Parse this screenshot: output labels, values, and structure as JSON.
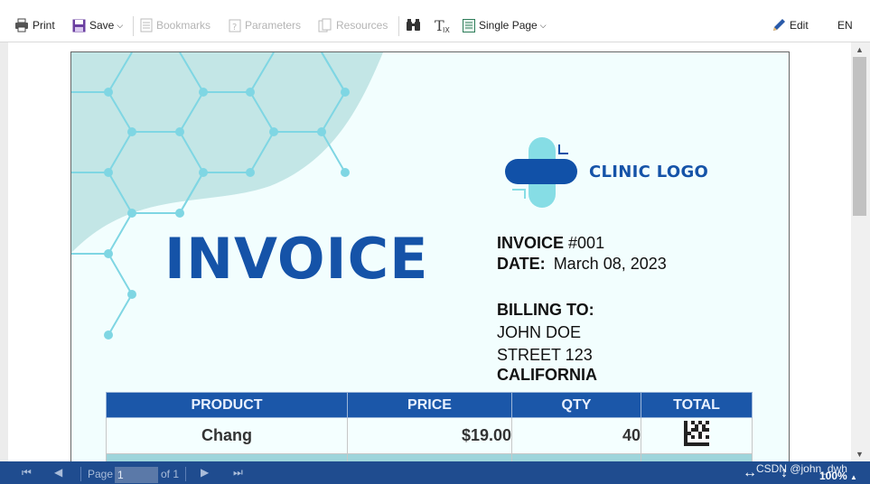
{
  "toolbar": {
    "print": "Print",
    "save": "Save",
    "bookmarks": "Bookmarks",
    "parameters": "Parameters",
    "resources": "Resources",
    "view_mode": "Single Page",
    "edit": "Edit",
    "language": "EN"
  },
  "invoice": {
    "logo_text": "CLINIC LOGO",
    "title": "INVOICE",
    "number_label": "INVOICE",
    "number_value": "#001",
    "date_label": "DATE:",
    "date_value": "March 08, 2023",
    "billing_label": "BILLING TO:",
    "billing_name": "JOHN DOE",
    "billing_street": "STREET 123",
    "billing_state": "CALIFORNIA"
  },
  "table": {
    "headers": [
      "PRODUCT",
      "PRICE",
      "QTY",
      "TOTAL"
    ],
    "rows": [
      {
        "product": "Chang",
        "price": "$19.00",
        "qty": "40"
      }
    ]
  },
  "navbar": {
    "page_label": "Page",
    "page_value": "1",
    "of_label": "of 1",
    "zoom": "100%"
  },
  "watermark": "CSDN @john_dwh",
  "colors": {
    "accent": "#1553a8",
    "nav_bg": "#1f4c8f",
    "hex_line": "#7fd6e3",
    "blob": "#c3e6e6"
  },
  "icons": [
    "print-icon",
    "save-icon",
    "bookmarks-icon",
    "parameters-icon",
    "resources-icon",
    "find-icon",
    "text-icon",
    "single-page-icon",
    "edit-pencil-icon"
  ]
}
